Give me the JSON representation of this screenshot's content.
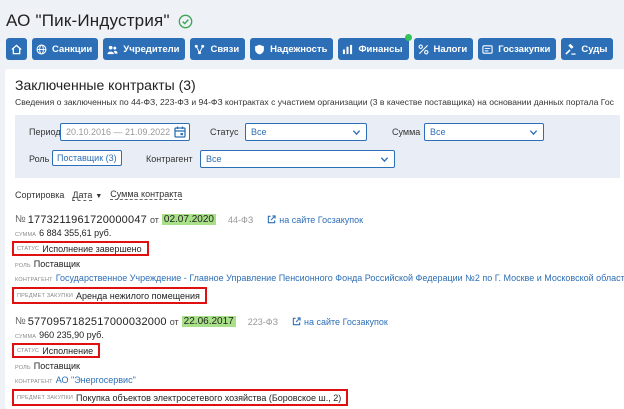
{
  "company": {
    "name": "АО \"Пик-Индустрия\""
  },
  "nav": [
    {
      "label": "",
      "icon": "home-icon"
    },
    {
      "label": "Санкции",
      "icon": "globe-icon"
    },
    {
      "label": "Учредители",
      "icon": "users-icon"
    },
    {
      "label": "Связи",
      "icon": "network-icon"
    },
    {
      "label": "Надежность",
      "icon": "shield-icon"
    },
    {
      "label": "Финансы",
      "icon": "chart-icon"
    },
    {
      "label": "Налоги",
      "icon": "percent-icon"
    },
    {
      "label": "Госзакупки",
      "icon": "document-icon"
    },
    {
      "label": "Суды",
      "icon": "gavel-icon"
    }
  ],
  "section": {
    "title": "Заключенные контракты (3)",
    "description": "Сведения о заключенных по 44-ФЗ, 223-ФЗ и 94-ФЗ контрактах с участием организации (3 в качестве поставщика) на основании данных портала Гос"
  },
  "filters": {
    "period_label": "Период",
    "period_value": "20.10.2016 — 21.09.2022",
    "status_label": "Статус",
    "status_value": "Все",
    "sum_label": "Сумма",
    "sum_value": "Все",
    "role_label": "Роль",
    "role_value": "Поставщик (3)",
    "counterparty_label": "Контрагент",
    "counterparty_value": "Все"
  },
  "sort": {
    "label": "Сортировка",
    "by_date": "Дата",
    "by_sum": "Сумма контракта"
  },
  "labels": {
    "number_prefix": "№",
    "date_prefix": "от",
    "gov_link": "на сайте Госзакупок",
    "sum": "Сумма",
    "status": "Статус",
    "role": "Роль",
    "counterparty": "Контрагент",
    "subject": "Предмет закупки"
  },
  "contracts": [
    {
      "number": "1773211961720000047",
      "date": "02.07.2020",
      "law": "44-ФЗ",
      "sum": "6 884 355,61 руб.",
      "status": "Исполнение завершено",
      "role": "Поставщик",
      "counterparty": "Государственное Учреждение - Главное Управление Пенсионного Фонда Российской Федерации №2 по Г. Москве и Московской области",
      "subject": "Аренда нежилого помещения"
    },
    {
      "number": "5770957182517000032000",
      "date": "22.06.2017",
      "law": "223-ФЗ",
      "sum": "960 235,90 руб.",
      "status": "Исполнение",
      "role": "Поставщик",
      "counterparty": "АО \"Энергосервис\"",
      "subject": "Покупка объектов электросетевого хозяйства (Боровское ш., 2)"
    }
  ],
  "colors": {
    "accent": "#2d6fb6",
    "highlight": "#a8e088",
    "annotation": "#e01010"
  }
}
